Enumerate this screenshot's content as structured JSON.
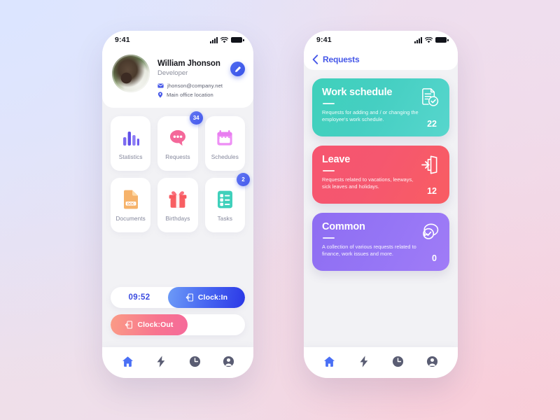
{
  "background": {
    "gradient_from": "#dce5ff",
    "gradient_to": "#f9ccd8"
  },
  "left_screen": {
    "status_bar": {
      "time": "9:41",
      "icons": [
        "signal-icon",
        "wifi-icon",
        "battery-icon"
      ]
    },
    "profile": {
      "name": "William Jhonson",
      "role": "Developer",
      "email": "jhonson@company.net",
      "location": "Main office location",
      "edit_label": "",
      "accent": "#3a54e8"
    },
    "tiles": [
      {
        "label": "Statistics",
        "icon": "bar-chart-icon",
        "color": "#6c5ce7",
        "badge": null
      },
      {
        "label": "Requests",
        "icon": "chat-bubble-icon",
        "color": "#f4689a",
        "badge": "34"
      },
      {
        "label": "Schedules",
        "icon": "calendar-icon",
        "color": "#e87ef0",
        "badge": null
      },
      {
        "label": "Documents",
        "icon": "document-icon",
        "color": "#f5a962",
        "badge": null
      },
      {
        "label": "Birthdays",
        "icon": "gift-icon",
        "color": "#f85f63",
        "badge": null
      },
      {
        "label": "Tasks",
        "icon": "checklist-icon",
        "color": "#3fd0bb",
        "badge": "2"
      }
    ],
    "clock": {
      "time": "09:52",
      "clock_in_label": "Clock:In",
      "clock_out_label": "Clock:Out",
      "in_color": "#3a54e8",
      "out_color": "#f8748f"
    },
    "bottom_nav": [
      {
        "icon": "home-icon",
        "active": true
      },
      {
        "icon": "bolt-icon",
        "active": false
      },
      {
        "icon": "clock-icon",
        "active": false
      },
      {
        "icon": "user-icon",
        "active": false
      }
    ]
  },
  "right_screen": {
    "status_bar": {
      "time": "9:41",
      "icons": [
        "signal-icon",
        "wifi-icon",
        "battery-icon"
      ]
    },
    "header": {
      "back_label": "",
      "title": "Requests"
    },
    "cards": [
      {
        "title": "Work schedule",
        "description": "Requests for adding and / or changing the employee's work schedule.",
        "count": "22",
        "icon": "document-check-icon",
        "color": "#45cfc2"
      },
      {
        "title": "Leave",
        "description": "Requests related to vacations, leeways, sick leaves and holidays.",
        "count": "12",
        "icon": "exit-door-icon",
        "color": "#f5576f"
      },
      {
        "title": "Common",
        "description": "A collection of various requests related to finance, work issues and more.",
        "count": "0",
        "icon": "chat-check-icon",
        "color": "#9575f5"
      }
    ],
    "bottom_nav": [
      {
        "icon": "home-icon",
        "active": true
      },
      {
        "icon": "bolt-icon",
        "active": false
      },
      {
        "icon": "clock-icon",
        "active": false
      },
      {
        "icon": "user-icon",
        "active": false
      }
    ]
  }
}
